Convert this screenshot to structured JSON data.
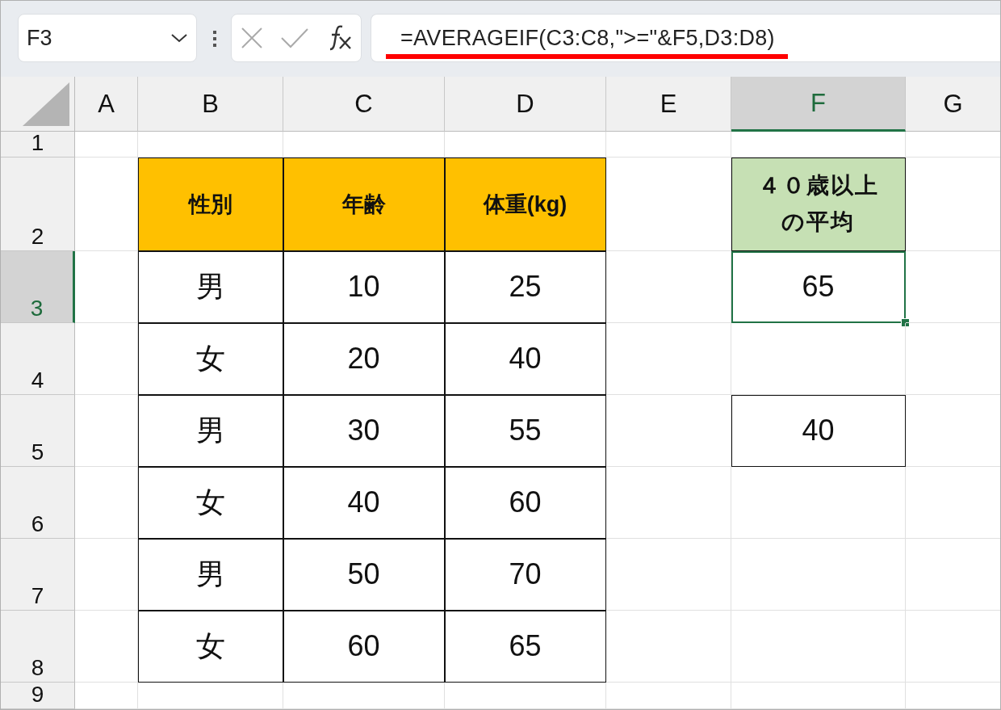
{
  "name_box": {
    "value": "F3"
  },
  "formula_bar": {
    "value": "=AVERAGEIF(C3:C8,\">=\"&F5,D3:D8)",
    "underlined": true
  },
  "columns": [
    {
      "label": "A",
      "selected": false
    },
    {
      "label": "B",
      "selected": false
    },
    {
      "label": "C",
      "selected": false
    },
    {
      "label": "D",
      "selected": false
    },
    {
      "label": "E",
      "selected": false
    },
    {
      "label": "F",
      "selected": true
    },
    {
      "label": "G",
      "selected": false
    }
  ],
  "rows": [
    {
      "label": "1",
      "selected": false,
      "cells": [
        {
          "selected": false
        },
        {
          "selected": false
        },
        {
          "selected": false
        },
        {
          "selected": false
        },
        {
          "selected": false
        },
        {
          "selected": false
        },
        {
          "selected": false
        }
      ]
    },
    {
      "label": "2",
      "selected": false,
      "cells": [
        {
          "selected": false
        },
        {
          "selected": false,
          "text": "性別",
          "kind": "header"
        },
        {
          "selected": false,
          "text": "年齢",
          "kind": "header"
        },
        {
          "selected": false,
          "text": "体重(kg)",
          "kind": "header"
        },
        {
          "selected": false
        },
        {
          "selected": false,
          "text": "４０歳以上の平均",
          "kind": "result_header"
        },
        {
          "selected": false
        }
      ]
    },
    {
      "label": "3",
      "selected": true,
      "cells": [
        {
          "selected": false
        },
        {
          "selected": false,
          "text": "男",
          "kind": "data"
        },
        {
          "selected": false,
          "text": "10",
          "kind": "data"
        },
        {
          "selected": false,
          "text": "25",
          "kind": "data"
        },
        {
          "selected": false
        },
        {
          "selected": true,
          "text": "65",
          "kind": "data"
        },
        {
          "selected": false
        }
      ]
    },
    {
      "label": "4",
      "selected": false,
      "cells": [
        {
          "selected": false
        },
        {
          "selected": false,
          "text": "女",
          "kind": "data"
        },
        {
          "selected": false,
          "text": "20",
          "kind": "data"
        },
        {
          "selected": false,
          "text": "40",
          "kind": "data"
        },
        {
          "selected": false
        },
        {
          "selected": false
        },
        {
          "selected": false
        }
      ]
    },
    {
      "label": "5",
      "selected": false,
      "cells": [
        {
          "selected": false
        },
        {
          "selected": false,
          "text": "男",
          "kind": "data"
        },
        {
          "selected": false,
          "text": "30",
          "kind": "data"
        },
        {
          "selected": false,
          "text": "55",
          "kind": "data"
        },
        {
          "selected": false
        },
        {
          "selected": false,
          "text": "40",
          "kind": "data"
        },
        {
          "selected": false
        }
      ]
    },
    {
      "label": "6",
      "selected": false,
      "cells": [
        {
          "selected": false
        },
        {
          "selected": false,
          "text": "女",
          "kind": "data"
        },
        {
          "selected": false,
          "text": "40",
          "kind": "data"
        },
        {
          "selected": false,
          "text": "60",
          "kind": "data"
        },
        {
          "selected": false
        },
        {
          "selected": false
        },
        {
          "selected": false
        }
      ]
    },
    {
      "label": "7",
      "selected": false,
      "cells": [
        {
          "selected": false
        },
        {
          "selected": false,
          "text": "男",
          "kind": "data"
        },
        {
          "selected": false,
          "text": "50",
          "kind": "data"
        },
        {
          "selected": false,
          "text": "70",
          "kind": "data"
        },
        {
          "selected": false
        },
        {
          "selected": false
        },
        {
          "selected": false
        }
      ]
    },
    {
      "label": "8",
      "selected": false,
      "cells": [
        {
          "selected": false
        },
        {
          "selected": false,
          "text": "女",
          "kind": "data"
        },
        {
          "selected": false,
          "text": "60",
          "kind": "data"
        },
        {
          "selected": false,
          "text": "65",
          "kind": "data"
        },
        {
          "selected": false
        },
        {
          "selected": false
        },
        {
          "selected": false
        }
      ]
    },
    {
      "label": "9",
      "selected": false,
      "cells": [
        {
          "selected": false
        },
        {
          "selected": false
        },
        {
          "selected": false
        },
        {
          "selected": false
        },
        {
          "selected": false
        },
        {
          "selected": false
        },
        {
          "selected": false
        }
      ]
    }
  ]
}
